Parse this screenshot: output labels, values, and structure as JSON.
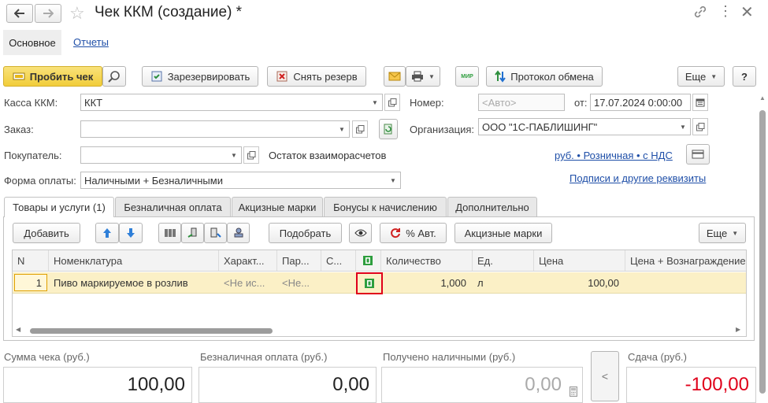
{
  "window": {
    "title": "Чек ККМ (создание) *"
  },
  "nav_tabs": [
    "Основное",
    "Отчеты"
  ],
  "toolbar": {
    "punch_label": "Пробить чек",
    "reserve_label": "Зарезервировать",
    "unreserve_label": "Снять резерв",
    "mir_label": "МИР",
    "protocol_label": "Протокол обмена",
    "more_label": "Еще",
    "help_label": "?"
  },
  "form": {
    "kassa_label": "Касса ККМ:",
    "kassa_value": "ККТ",
    "order_label": "Заказ:",
    "order_value": "",
    "buyer_label": "Покупатель:",
    "buyer_value": "",
    "balance_label": "Остаток взаиморасчетов",
    "payment_label": "Форма оплаты:",
    "payment_value": "Наличными + Безналичными",
    "number_label": "Номер:",
    "number_placeholder": "<Авто>",
    "date_label": "от:",
    "date_value": "17.07.2024  0:00:00",
    "org_label": "Организация:",
    "org_value": "ООО \"1С-ПАБЛИШИНГ\"",
    "price_link": "руб. • Розничная • с НДС",
    "signatures_link": "Подписи и другие реквизиты"
  },
  "tabs": [
    "Товары и услуги (1)",
    "Безналичная оплата",
    "Акцизные марки",
    "Бонусы к начислению",
    "Дополнительно"
  ],
  "table_toolbar": {
    "add_label": "Добавить",
    "pick_label": "Подобрать",
    "percent_label": "% Авт.",
    "excise_label": "Акцизные марки",
    "more_label": "Еще"
  },
  "table": {
    "columns": [
      "N",
      "Номенклатура",
      "Характ...",
      "Пар...",
      "С...",
      "",
      "Количество",
      "Ед.",
      "Цена",
      "Цена + Вознаграждение"
    ],
    "rows": [
      {
        "n": "1",
        "item": "Пиво маркируемое в розлив",
        "characteristic": "<Не ис...",
        "batch": "<Не...",
        "series": "",
        "quantity": "1,000",
        "unit": "л",
        "price": "100,00",
        "price_reward": ""
      }
    ]
  },
  "totals": {
    "sum_label": "Сумма чека (руб.)",
    "sum_value": "100,00",
    "cashless_label": "Безналичная оплата (руб.)",
    "cashless_value": "0,00",
    "cash_label": "Получено наличными (руб.)",
    "cash_value": "0,00",
    "change_label": "Сдача (руб.)",
    "change_value": "-100,00",
    "arrow_label": "<"
  },
  "colors": {
    "punch_button": "#f5d44a",
    "selected_row": "#fbf0c6",
    "highlight_border": "#e0001a",
    "change_value": "#e0001a",
    "excise_icon": "#2e9e3e"
  }
}
